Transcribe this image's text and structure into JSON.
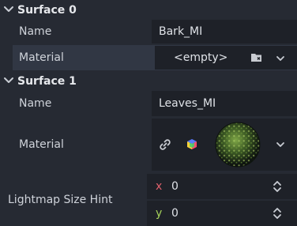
{
  "surfaces": [
    {
      "title": "Surface 0",
      "name_label": "Name",
      "name_value": "Bark_MI",
      "material_label": "Material",
      "material_value": "<empty>",
      "material_icons": [
        "load-folder-icon",
        "chevron-down-icon"
      ]
    },
    {
      "title": "Surface 1",
      "name_label": "Name",
      "name_value": "Leaves_MI",
      "material_label": "Material",
      "material_icons": [
        "link-icon",
        "cube-icon",
        "material-preview-thumbnail",
        "chevron-down-icon"
      ]
    }
  ],
  "lightmap": {
    "label": "Lightmap Size Hint",
    "x_label": "x",
    "x_value": "0",
    "y_label": "y",
    "y_value": "0",
    "x_color": "#e0616c",
    "y_color": "#a5d25a"
  },
  "colors": {
    "panel_bg": "#262a33",
    "field_bg": "#1e2128",
    "highlight_row": "#313744"
  }
}
